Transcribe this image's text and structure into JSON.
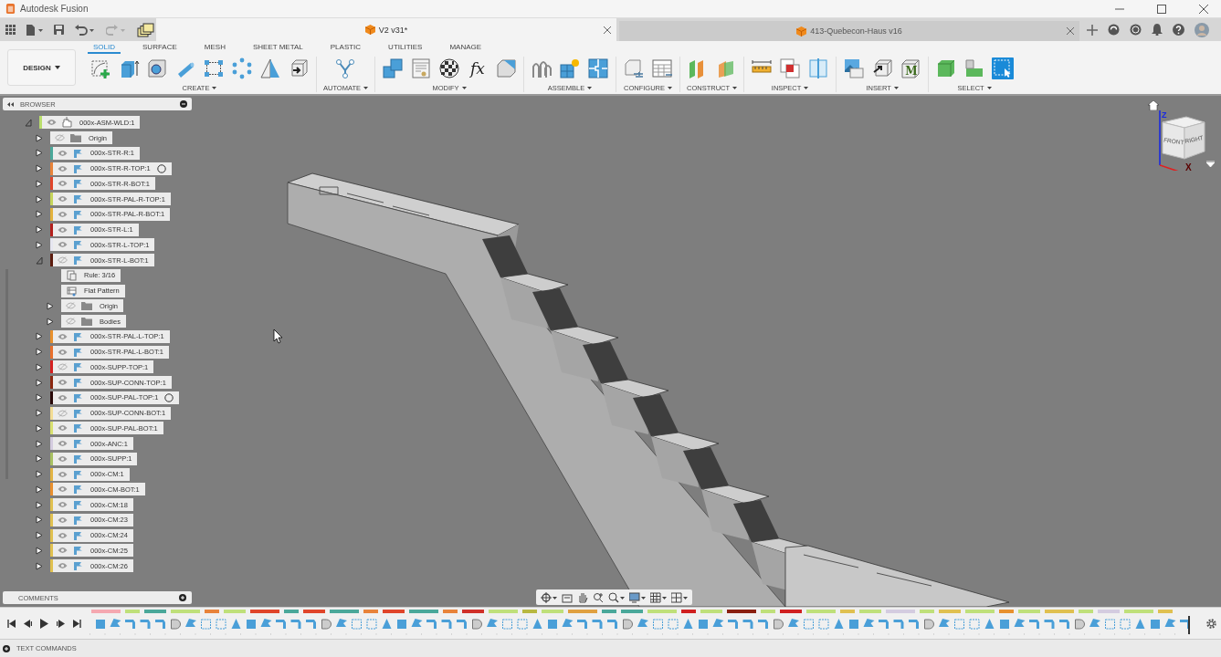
{
  "window": {
    "title": "Autodesk Fusion"
  },
  "document_tabs": [
    {
      "title": "V2 v31*",
      "selected": true
    },
    {
      "title": "413-Quebecon-Haus v16",
      "selected": false
    }
  ],
  "workspace": {
    "label": "DESIGN"
  },
  "toolbar_tabs": [
    {
      "label": "SOLID",
      "selected": true
    },
    {
      "label": "SURFACE",
      "selected": false
    },
    {
      "label": "MESH",
      "selected": false
    },
    {
      "label": "SHEET METAL",
      "selected": false
    },
    {
      "label": "PLASTIC",
      "selected": false
    },
    {
      "label": "UTILITIES",
      "selected": false
    },
    {
      "label": "MANAGE",
      "selected": false
    }
  ],
  "tool_groups": [
    {
      "label": "CREATE",
      "tools": [
        {
          "kind": "sketch",
          "selected": false
        },
        {
          "kind": "extrude",
          "selected": false
        },
        {
          "kind": "hole",
          "selected": false
        },
        {
          "kind": "pipe",
          "selected": false
        },
        {
          "kind": "rectpattern",
          "selected": false
        },
        {
          "kind": "circpattern",
          "selected": false
        },
        {
          "kind": "web",
          "selected": false
        },
        {
          "kind": "derive",
          "selected": false
        }
      ]
    },
    {
      "label": "AUTOMATE",
      "tools": [
        {
          "kind": "automate",
          "selected": false
        }
      ]
    },
    {
      "label": "MODIFY",
      "tools": [
        {
          "kind": "combine",
          "selected": false
        },
        {
          "kind": "parameters",
          "selected": false
        },
        {
          "kind": "appearance",
          "selected": false
        },
        {
          "kind": "formula",
          "glyph": "fx",
          "selected": false
        },
        {
          "kind": "chamfer",
          "selected": false
        }
      ]
    },
    {
      "label": "ASSEMBLE",
      "tools": [
        {
          "kind": "joints",
          "selected": false
        },
        {
          "kind": "newcomponent",
          "selected": false
        },
        {
          "kind": "puzzle",
          "selected": false
        }
      ]
    },
    {
      "label": "CONFIGURE",
      "tools": [
        {
          "kind": "configure",
          "selected": false
        },
        {
          "kind": "table",
          "selected": false
        }
      ]
    },
    {
      "label": "CONSTRUCT",
      "tools": [
        {
          "kind": "plane",
          "selected": false
        },
        {
          "kind": "planeangle",
          "selected": false
        }
      ]
    },
    {
      "label": "INSPECT",
      "tools": [
        {
          "kind": "measure",
          "selected": false
        },
        {
          "kind": "interference",
          "selected": false
        },
        {
          "kind": "section",
          "selected": false
        }
      ]
    },
    {
      "label": "INSERT",
      "tools": [
        {
          "kind": "canvas",
          "selected": false
        },
        {
          "kind": "insertarrow",
          "selected": false
        },
        {
          "kind": "mcad",
          "glyph": "M",
          "selected": false
        }
      ]
    },
    {
      "label": "SELECT",
      "tools": [
        {
          "kind": "selectbody",
          "selected": false
        },
        {
          "kind": "selectface",
          "selected": false
        },
        {
          "kind": "window",
          "selected": true
        }
      ]
    }
  ],
  "browser": {
    "title": "BROWSER",
    "tree": [
      {
        "label": "000x-ASM-WLD:1",
        "kind": "assembly",
        "color": "#b9de6c",
        "visible": true,
        "expanded": true,
        "children": [
          {
            "label": "Origin",
            "kind": "folder",
            "visible": false,
            "expanded": false
          },
          {
            "label": "000x-STR-R:1",
            "kind": "component",
            "color": "#4aa89a",
            "visible": true,
            "expanded": false
          },
          {
            "label": "000x-STR-R-TOP:1",
            "kind": "component",
            "color": "#e8833a",
            "visible": true,
            "expanded": false,
            "activate_marker": true
          },
          {
            "label": "000x-STR-R-BOT:1",
            "kind": "component",
            "color": "#e0452a",
            "visible": true,
            "expanded": false
          },
          {
            "label": "000x-STR-PAL-R-TOP:1",
            "kind": "component",
            "color": "#c5d45a",
            "visible": true,
            "expanded": false
          },
          {
            "label": "000x-STR-PAL-R-BOT:1",
            "kind": "component",
            "color": "#e3b23c",
            "visible": true,
            "expanded": false
          },
          {
            "label": "000x-STR-L:1",
            "kind": "component",
            "color": "#b3201c",
            "visible": true,
            "expanded": false
          },
          {
            "label": "000x-STR-L-TOP:1",
            "kind": "component",
            "color": "#e6e6f0",
            "visible": true,
            "expanded": false
          },
          {
            "label": "000x-STR-L-BOT:1",
            "kind": "component",
            "color": "#5c1c0e",
            "visible": false,
            "expanded": true,
            "children": [
              {
                "label": "Rule: 3/16",
                "kind": "rule"
              },
              {
                "label": "Flat Pattern",
                "kind": "flatpattern"
              },
              {
                "label": "Origin",
                "kind": "folder",
                "visible": false,
                "expanded": false
              },
              {
                "label": "Bodies",
                "kind": "folder",
                "visible": false,
                "expanded": false
              }
            ]
          },
          {
            "label": "000x-STR-PAL-L-TOP:1",
            "kind": "component",
            "color": "#e8902c",
            "visible": true,
            "expanded": false
          },
          {
            "label": "000x-STR-PAL-L-BOT:1",
            "kind": "component",
            "color": "#e8702c",
            "visible": true,
            "expanded": false
          },
          {
            "label": "000x-SUPP-TOP:1",
            "kind": "component",
            "color": "#d42020",
            "visible": false,
            "expanded": false
          },
          {
            "label": "000x-SUP-CONN-TOP:1",
            "kind": "component",
            "color": "#8c2810",
            "visible": true,
            "expanded": false
          },
          {
            "label": "000x-SUP-PAL-TOP:1",
            "kind": "component",
            "color": "#2a0808",
            "visible": true,
            "expanded": false,
            "activate_marker": true
          },
          {
            "label": "000x-SUP-CONN-BOT:1",
            "kind": "component",
            "color": "#f2dc94",
            "visible": false,
            "expanded": false
          },
          {
            "label": "000x-SUP-PAL-BOT:1",
            "kind": "component",
            "color": "#d8e070",
            "visible": true,
            "expanded": false
          },
          {
            "label": "000x-ANC:1",
            "kind": "component",
            "color": "#d4cce0",
            "visible": true,
            "expanded": false
          },
          {
            "label": "000x-SUPP:1",
            "kind": "component",
            "color": "#a8c062",
            "visible": true,
            "expanded": false
          },
          {
            "label": "000x-CM:1",
            "kind": "component",
            "color": "#e2b444",
            "visible": true,
            "expanded": false
          },
          {
            "label": "000x-CM-BOT:1",
            "kind": "component",
            "color": "#e8902e",
            "visible": true,
            "expanded": false
          },
          {
            "label": "000x-CM:18",
            "kind": "component",
            "color": "#e0c050",
            "visible": true,
            "expanded": false
          },
          {
            "label": "000x-CM:23",
            "kind": "component",
            "color": "#e0c050",
            "visible": true,
            "expanded": false
          },
          {
            "label": "000x-CM:24",
            "kind": "component",
            "color": "#e0c050",
            "visible": true,
            "expanded": false
          },
          {
            "label": "000x-CM:25",
            "kind": "component",
            "color": "#e0c050",
            "visible": true,
            "expanded": false
          },
          {
            "label": "000x-CM:26",
            "kind": "component",
            "color": "#e0c050",
            "visible": true,
            "expanded": false
          }
        ]
      }
    ]
  },
  "view_cube": {
    "faces": [
      "FRONT",
      "RIGHT"
    ],
    "axes": [
      "Z",
      "X"
    ]
  },
  "comments": {
    "title": "COMMENTS"
  },
  "text_commands": {
    "title": "TEXT COMMANDS"
  }
}
